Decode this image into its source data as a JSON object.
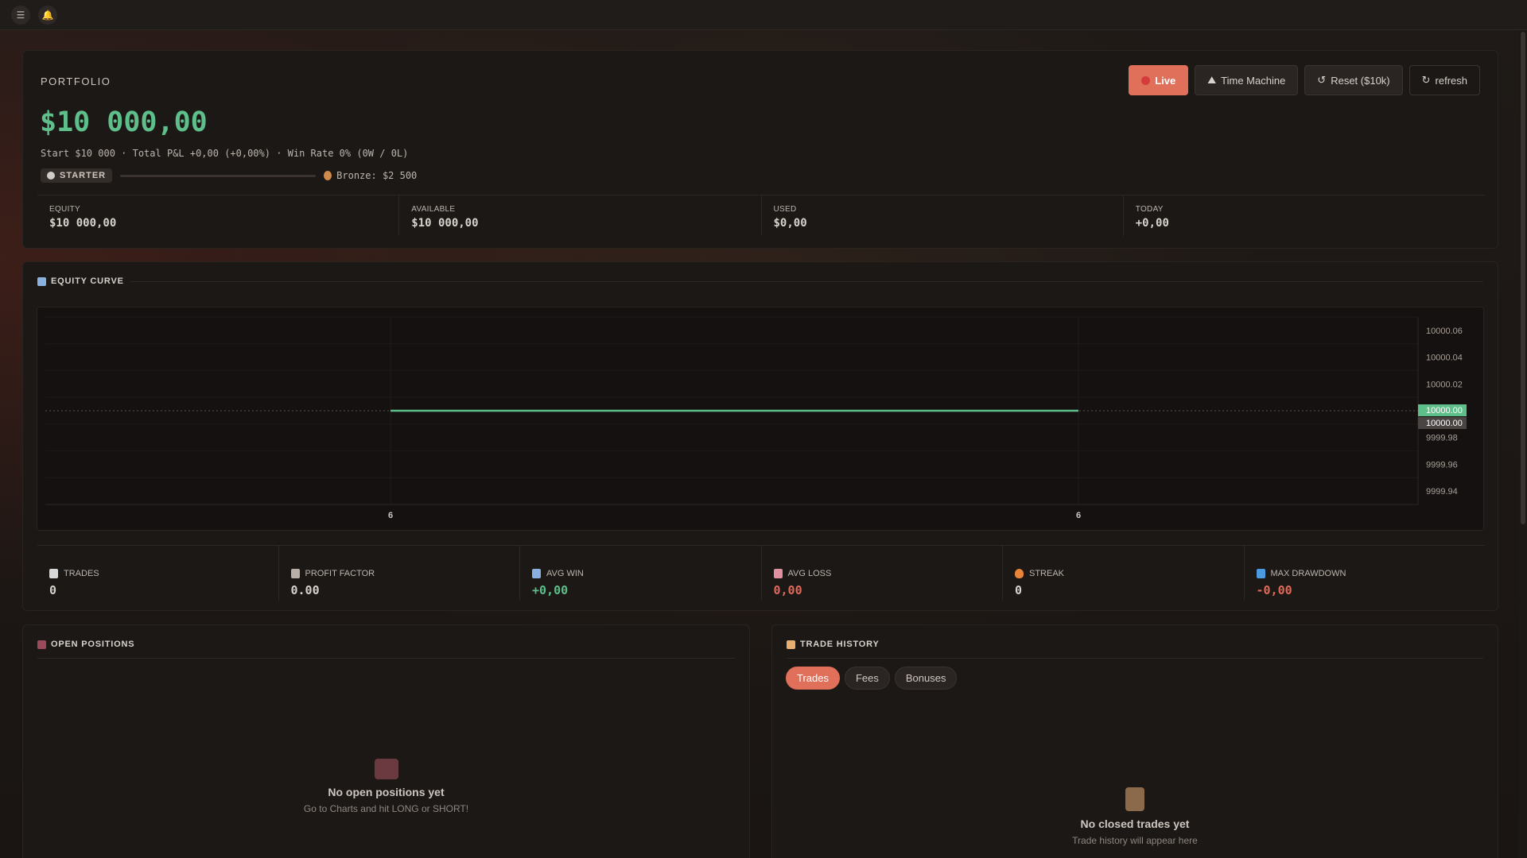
{
  "topbar": {
    "menu_icon": "menu-icon",
    "bell_icon": "bell-icon"
  },
  "portfolio": {
    "title": "PORTFOLIO",
    "balance": "$10 000,00",
    "subtitle": "Start $10 000 · Total P&L +0,00 (+0,00%) · Win Rate 0% (0W / 0L)",
    "tier": "STARTER",
    "tier_progress": 0,
    "next_tier": "Bronze: $2 500",
    "buttons": {
      "live": "Live",
      "time_machine": "Time Machine",
      "reset": "Reset ($10k)",
      "refresh": "refresh"
    },
    "stats": [
      {
        "label": "EQUITY",
        "value": "$10 000,00"
      },
      {
        "label": "AVAILABLE",
        "value": "$10 000,00"
      },
      {
        "label": "USED",
        "value": "$0,00"
      },
      {
        "label": "TODAY",
        "value": "+0,00"
      }
    ]
  },
  "equity": {
    "title": "EQUITY CURVE",
    "stats": [
      {
        "label": "TRADES",
        "value": "0",
        "icon": "document-icon"
      },
      {
        "label": "PROFIT FACTOR",
        "value": "0.00",
        "icon": "scale-icon"
      },
      {
        "label": "AVG WIN",
        "value": "+0,00",
        "icon": "chart-up-icon"
      },
      {
        "label": "AVG LOSS",
        "value": "0,00",
        "icon": "chart-down-icon"
      },
      {
        "label": "STREAK",
        "value": "0",
        "icon": "fire-icon"
      },
      {
        "label": "MAX DRAWDOWN",
        "value": "-0,00",
        "icon": "drawdown-icon"
      }
    ]
  },
  "chart_data": {
    "type": "line",
    "x": [
      "6",
      "6"
    ],
    "series": [
      {
        "values": [
          10000.0,
          10000.0
        ]
      }
    ],
    "y_ticks": [
      "10000.06",
      "10000.04",
      "10000.02",
      "9999.98",
      "9999.96",
      "9999.94"
    ],
    "y_markers": [
      "10000.00",
      "10000.00"
    ],
    "ylim": [
      9999.93,
      10000.07
    ],
    "colors": {
      "line": "#5fbf8a",
      "marker_green": "#5fbf8a",
      "marker_gray": "#4a4442"
    }
  },
  "positions": {
    "title": "OPEN POSITIONS",
    "empty_title": "No open positions yet",
    "empty_sub": "Go to Charts and hit LONG or SHORT!"
  },
  "history": {
    "title": "TRADE HISTORY",
    "tabs": [
      "Trades",
      "Fees",
      "Bonuses"
    ],
    "empty_title": "No closed trades yet",
    "empty_sub": "Trade history will appear here"
  }
}
